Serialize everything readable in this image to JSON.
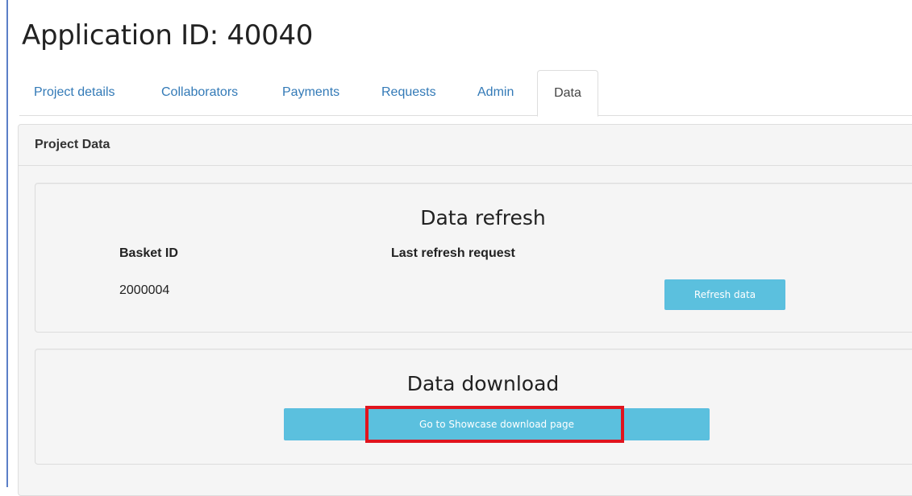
{
  "page": {
    "title": "Application ID: 40040"
  },
  "tabs": [
    {
      "label": "Project details",
      "active": false
    },
    {
      "label": "Collaborators",
      "active": false
    },
    {
      "label": "Payments",
      "active": false
    },
    {
      "label": "Requests",
      "active": false
    },
    {
      "label": "Admin",
      "active": false
    },
    {
      "label": "Data",
      "active": true
    }
  ],
  "panel": {
    "heading": "Project Data",
    "refresh": {
      "title": "Data refresh",
      "columns": [
        "Basket ID",
        "Last refresh request"
      ],
      "basket_id": "2000004",
      "last_refresh": "",
      "button_label": "Refresh data"
    },
    "download": {
      "title": "Data download",
      "button_label": "Go to Showcase download page"
    }
  },
  "colors": {
    "accent": "#5bc0de",
    "link": "#337ab7",
    "highlight": "#e0141e"
  }
}
